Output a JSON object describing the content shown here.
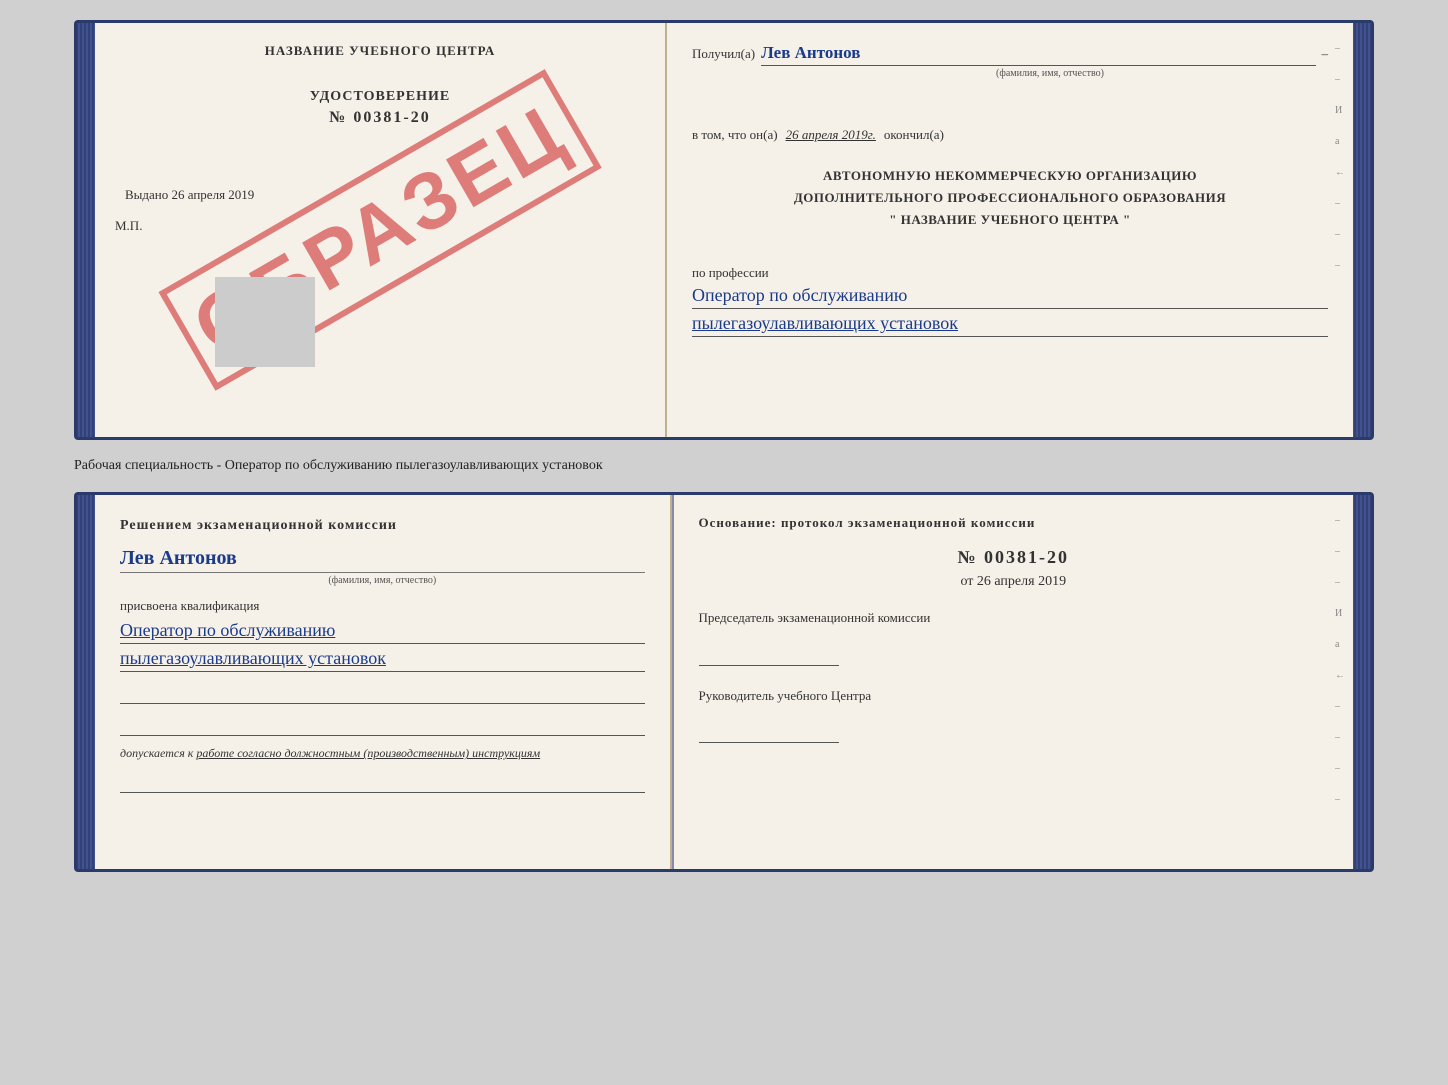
{
  "top_diploma": {
    "left_page": {
      "school_name": "НАЗВАНИЕ УЧЕБНОГО ЦЕНТРА",
      "watermark": "ОБРАЗЕЦ",
      "cert_title": "УДОСТОВЕРЕНИЕ",
      "cert_number": "№ 00381-20",
      "issued_label": "Выдано",
      "issued_date": "26 апреля 2019",
      "mp_label": "М.П."
    },
    "right_page": {
      "received_label": "Получил(а)",
      "recipient_name": "Лев Антонов",
      "fio_sublabel": "(фамилия, имя, отчество)",
      "date_prefix": "в том, что он(а)",
      "date_value": "26 апреля 2019г.",
      "finished_label": "окончил(а)",
      "org_line1": "АВТОНОМНУЮ НЕКОММЕРЧЕСКУЮ ОРГАНИЗАЦИЮ",
      "org_line2": "ДОПОЛНИТЕЛЬНОГО ПРОФЕССИОНАЛЬНОГО ОБРАЗОВАНИЯ",
      "org_line3": "\"  НАЗВАНИЕ УЧЕБНОГО ЦЕНТРА  \"",
      "profession_label": "по профессии",
      "profession_line1": "Оператор по обслуживанию",
      "profession_line2": "пылегазоулавливающих установок",
      "side_chars": [
        "–",
        "–",
        "И",
        "а",
        "←",
        "–",
        "–",
        "–",
        "–"
      ]
    }
  },
  "middle_text": "Рабочая специальность - Оператор по обслуживанию пылегазоулавливающих установок",
  "bottom_diploma": {
    "left_page": {
      "section_title": "Решением экзаменационной комиссии",
      "person_name": "Лев Антонов",
      "fio_sublabel": "(фамилия, имя, отчество)",
      "assigned_label": "присвоена квалификация",
      "qualification_line1": "Оператор по обслуживанию",
      "qualification_line2": "пылегазоулавливающих установок",
      "admission_prefix": "допускается к",
      "admission_text": "работе согласно должностным (производственным) инструкциям"
    },
    "right_page": {
      "basis_label": "Основание: протокол экзаменационной комиссии",
      "protocol_number": "№ 00381-20",
      "date_prefix": "от",
      "protocol_date": "26 апреля 2019",
      "chairman_role": "Председатель экзаменационной комиссии",
      "director_role": "Руководитель учебного Центра",
      "side_chars": [
        "–",
        "–",
        "–",
        "И",
        "а",
        "←",
        "–",
        "–",
        "–",
        "–"
      ]
    }
  }
}
